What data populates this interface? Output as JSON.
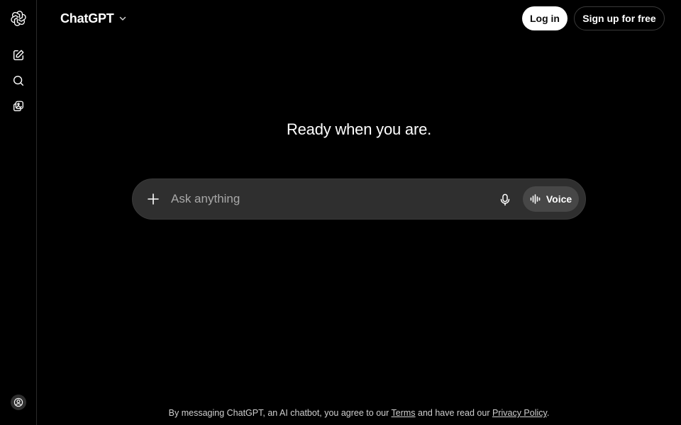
{
  "header": {
    "model_name": "ChatGPT",
    "login_label": "Log in",
    "signup_label": "Sign up for free"
  },
  "sidebar": {
    "icons": [
      "openai-logo-icon",
      "new-chat-icon",
      "search-icon",
      "library-icon",
      "profile-icon"
    ]
  },
  "main": {
    "title": "Ready when you are."
  },
  "composer": {
    "placeholder": "Ask anything",
    "voice_label": "Voice"
  },
  "footer": {
    "prefix": "By messaging ChatGPT, an AI chatbot, you agree to our ",
    "terms_label": "Terms",
    "middle": " and have read our ",
    "privacy_label": "Privacy Policy",
    "suffix": "."
  },
  "colors": {
    "background": "#000000",
    "composer_bg": "#2f2f2f",
    "voice_bg": "#474747",
    "text": "#ffffff",
    "placeholder": "#a8a8a8"
  }
}
